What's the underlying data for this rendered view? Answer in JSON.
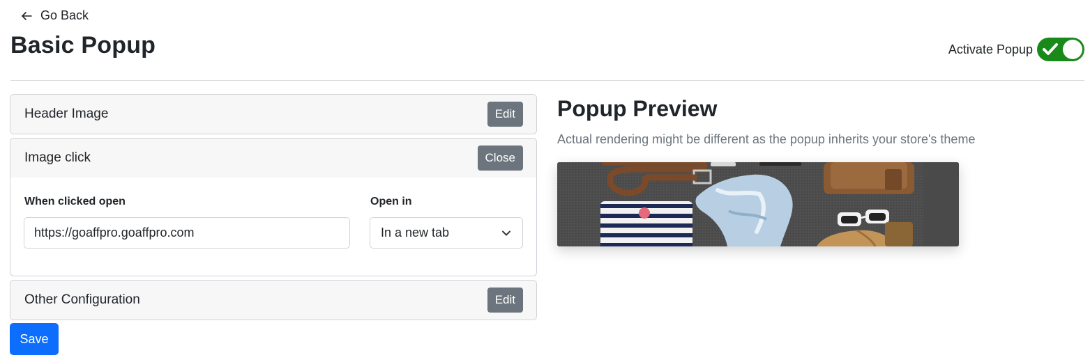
{
  "nav": {
    "back_label": "Go Back"
  },
  "page": {
    "title": "Basic Popup"
  },
  "activate": {
    "label": "Activate Popup",
    "enabled": true,
    "color": "#198a19"
  },
  "sections": {
    "header_image": {
      "title": "Header Image",
      "button": "Edit"
    },
    "image_click": {
      "title": "Image click",
      "button": "Close",
      "url_label": "When clicked open",
      "url_value": "https://goaffpro.goaffpro.com",
      "open_label": "Open in",
      "open_value": "In a new tab"
    },
    "other": {
      "title": "Other Configuration",
      "button": "Edit"
    }
  },
  "save_label": "Save",
  "preview": {
    "title": "Popup Preview",
    "subtitle": "Actual rendering might be different as the popup inherits your store's theme",
    "image_alt": "header-image-flatlay"
  },
  "colors": {
    "primary": "#0d6efd",
    "secondary": "#6c757d",
    "toggle_on": "#198a19"
  }
}
